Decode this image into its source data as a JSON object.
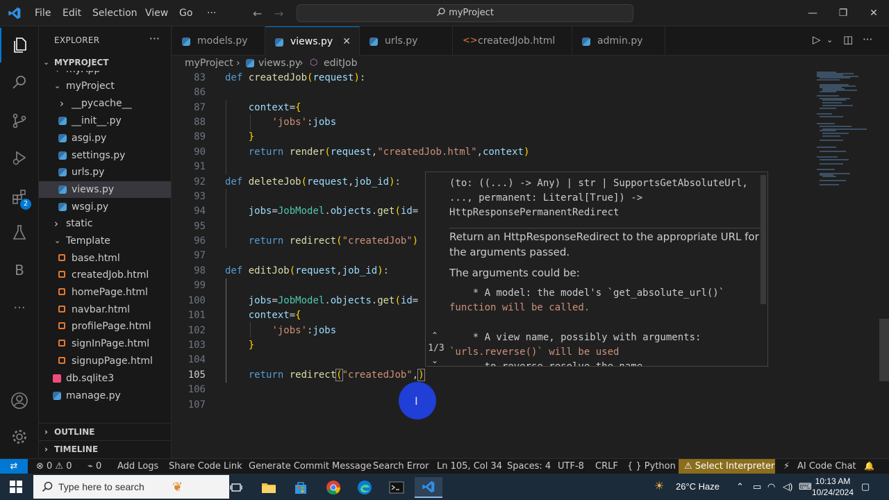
{
  "titlebar": {
    "menu": [
      "File",
      "Edit",
      "Selection",
      "View",
      "Go",
      "···"
    ],
    "search": "myProject",
    "window_buttons": [
      "—",
      "❐",
      "✕"
    ]
  },
  "activity_badge": "2",
  "sidebar": {
    "title": "EXPLORER",
    "more": "···",
    "project": "MYPROJECT",
    "items": [
      {
        "label": "myApp",
        "depth": 1,
        "kind": "folder-open"
      },
      {
        "label": "myProject",
        "depth": 1,
        "kind": "folder-open"
      },
      {
        "label": "__pycache__",
        "depth": 2,
        "kind": "folder"
      },
      {
        "label": "__init__.py",
        "depth": 2,
        "kind": "py"
      },
      {
        "label": "asgi.py",
        "depth": 2,
        "kind": "py"
      },
      {
        "label": "settings.py",
        "depth": 2,
        "kind": "py"
      },
      {
        "label": "urls.py",
        "depth": 2,
        "kind": "py"
      },
      {
        "label": "views.py",
        "depth": 2,
        "kind": "py",
        "selected": true
      },
      {
        "label": "wsgi.py",
        "depth": 2,
        "kind": "py"
      },
      {
        "label": "static",
        "depth": 1,
        "kind": "folder"
      },
      {
        "label": "Template",
        "depth": 1,
        "kind": "folder-open"
      },
      {
        "label": "base.html",
        "depth": 2,
        "kind": "html"
      },
      {
        "label": "createdJob.html",
        "depth": 2,
        "kind": "html"
      },
      {
        "label": "homePage.html",
        "depth": 2,
        "kind": "html"
      },
      {
        "label": "navbar.html",
        "depth": 2,
        "kind": "html"
      },
      {
        "label": "profilePage.html",
        "depth": 2,
        "kind": "html"
      },
      {
        "label": "signInPage.html",
        "depth": 2,
        "kind": "html"
      },
      {
        "label": "signupPage.html",
        "depth": 2,
        "kind": "html"
      },
      {
        "label": "db.sqlite3",
        "depth": 1,
        "kind": "db"
      },
      {
        "label": "manage.py",
        "depth": 1,
        "kind": "py"
      }
    ],
    "outline": "OUTLINE",
    "timeline": "TIMELINE"
  },
  "tabs": [
    {
      "label": "models.py",
      "kind": "py"
    },
    {
      "label": "views.py",
      "kind": "py",
      "active": true,
      "close": "✕"
    },
    {
      "label": "urls.py",
      "kind": "py"
    },
    {
      "label": "createdJob.html",
      "kind": "html"
    },
    {
      "label": "admin.py",
      "kind": "py"
    }
  ],
  "breadcrumb": {
    "root": "myProject",
    "file": "views.py",
    "symbol": "editJob",
    "sep": "›"
  },
  "editor": {
    "line_numbers": [
      "83",
      "86",
      "87",
      "88",
      "89",
      "90",
      "91",
      "92",
      "93",
      "94",
      "95",
      "96",
      "97",
      "98",
      "99",
      "100",
      "101",
      "102",
      "103",
      "104",
      "105",
      "106",
      "107"
    ],
    "current_line": "105"
  },
  "hover": {
    "signature": [
      "(to: ((...) -> Any) | str | SupportsGetAbsoluteUrl,",
      "..., permanent: Literal[True]) ->",
      "HttpResponsePermanentRedirect"
    ],
    "doc1": "Return an HttpResponseRedirect to the appropriate URL for the arguments passed.",
    "doc2": "The arguments could be:",
    "bullet1a": "    * A model: the model's `get_absolute_url()`",
    "bullet1b": "function will be called.",
    "bullet2a": "    * A view name, possibly with arguments:",
    "bullet2b": "`urls.reverse()` will be used",
    "bullet2c": "      to reverse-resolve the name.",
    "counter": "1/3"
  },
  "statusbar": {
    "remote": "⇄",
    "problems": "⊗ 0 ⚠ 0",
    "ports": "⌁ 0",
    "add_logs": "Add Logs",
    "share": "Share Code Link",
    "commit": "Generate Commit Message",
    "search_error": "Search Error",
    "position": "Ln 105, Col 34",
    "spaces": "Spaces: 4",
    "encoding": "UTF-8",
    "eol": "CRLF",
    "language": "{ } Python",
    "interpreter": "⚠ Select Interpreter",
    "ai_chat": "AI Code Chat",
    "bell": "🔔"
  },
  "taskbar": {
    "search_placeholder": "Type here to search",
    "weather": "26°C  Haze",
    "time": "10:13 AM",
    "date": "10/24/2024"
  },
  "colors": {
    "accent": "#0078d4",
    "editor_bg": "#1f1f1f",
    "sidebar_bg": "#181818",
    "keyword": "#569cd6",
    "function": "#dcdcaa",
    "string": "#ce9178",
    "warning_bg": "#8a6d1d"
  }
}
